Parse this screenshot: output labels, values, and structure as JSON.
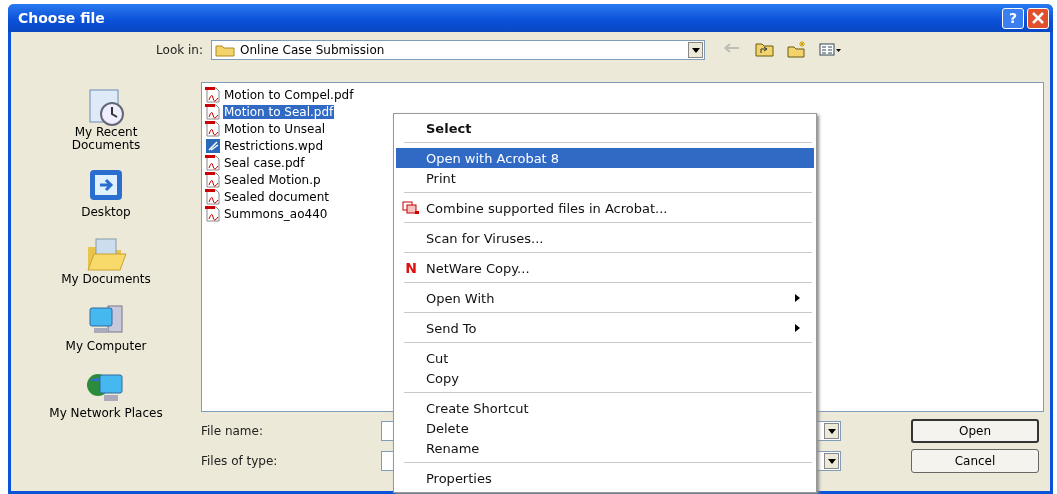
{
  "window": {
    "title": "Choose file",
    "help_button": "?"
  },
  "look_in": {
    "label": "Look in:",
    "value": "Online Case Submission"
  },
  "toolbar": [
    {
      "kind": "back",
      "disabled": true
    },
    {
      "kind": "up",
      "disabled": false
    },
    {
      "kind": "new-folder",
      "disabled": false
    },
    {
      "kind": "views",
      "disabled": false
    }
  ],
  "places": [
    {
      "kind": "recent",
      "label": "My Recent Documents"
    },
    {
      "kind": "desktop",
      "label": "Desktop"
    },
    {
      "kind": "documents",
      "label": "My Documents"
    },
    {
      "kind": "computer",
      "label": "My Computer"
    },
    {
      "kind": "network",
      "label": "My Network Places"
    }
  ],
  "files": [
    {
      "name": "Motion to Compel.pdf",
      "kind": "pdf",
      "selected": false
    },
    {
      "name": "Motion to Seal.pdf",
      "kind": "pdf",
      "selected": true
    },
    {
      "name": "Motion to Unseal",
      "kind": "pdf",
      "selected": false
    },
    {
      "name": "Restrictions.wpd",
      "kind": "wpd",
      "selected": false
    },
    {
      "name": "Seal case.pdf",
      "kind": "pdf",
      "selected": false
    },
    {
      "name": "Sealed Motion.p",
      "kind": "pdf",
      "selected": false
    },
    {
      "name": "Sealed document",
      "kind": "pdf",
      "selected": false
    },
    {
      "name": "Summons_ao440",
      "kind": "pdf",
      "selected": false
    }
  ],
  "file_name": {
    "label": "File name:"
  },
  "files_of_type": {
    "label": "Files of type:"
  },
  "buttons": [
    {
      "label": "Open",
      "default": true
    },
    {
      "label": "Cancel",
      "default": false
    }
  ],
  "context_menu": {
    "groups": [
      [
        {
          "label": "Select",
          "bold": true,
          "selected": false
        }
      ],
      [
        {
          "label": "Open with Acrobat 8",
          "bold": false,
          "selected": true
        },
        {
          "label": "Print",
          "bold": false,
          "selected": false
        }
      ],
      [
        {
          "label": "Combine supported files in Acrobat...",
          "bold": false,
          "selected": false,
          "kind": "combine"
        }
      ],
      [
        {
          "label": "Scan for Viruses...",
          "bold": false,
          "selected": false
        }
      ],
      [
        {
          "label": "NetWare Copy...",
          "bold": false,
          "selected": false,
          "badge": "N"
        }
      ],
      [
        {
          "label": "Open With",
          "bold": false,
          "selected": false,
          "submenu": true
        }
      ],
      [
        {
          "label": "Send To",
          "bold": false,
          "selected": false,
          "submenu": true
        }
      ],
      [
        {
          "label": "Cut",
          "bold": false,
          "selected": false
        },
        {
          "label": "Copy",
          "bold": false,
          "selected": false
        }
      ],
      [
        {
          "label": "Create Shortcut",
          "bold": false,
          "selected": false
        },
        {
          "label": "Delete",
          "bold": false,
          "selected": false
        },
        {
          "label": "Rename",
          "bold": false,
          "selected": false
        }
      ],
      [
        {
          "label": "Properties",
          "bold": false,
          "selected": false
        }
      ]
    ]
  }
}
